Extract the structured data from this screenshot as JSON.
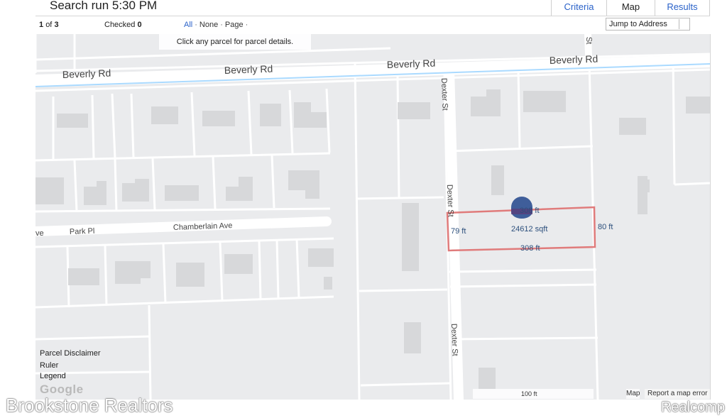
{
  "header": {
    "title": "Search run 5:30 PM",
    "tabs": {
      "criteria": "Criteria",
      "map": "Map",
      "results": "Results"
    }
  },
  "toolbar": {
    "position": "1",
    "of": "of",
    "total": "3",
    "checked_label": "Checked",
    "checked_count": "0",
    "selectors": {
      "all": "All",
      "none": "None",
      "page": "Page"
    },
    "jump_label": "Jump to Address"
  },
  "map": {
    "hint": "Click any parcel for parcel details.",
    "roads": {
      "beverly_1": "Beverly Rd",
      "beverly_2": "Beverly Rd",
      "beverly_3": "Beverly Rd",
      "beverly_4": "Beverly Rd",
      "dexter_1": "Dexter St",
      "dexter_2": "Dexter St",
      "dexter_3": "Dexter St",
      "st_fragment": "St",
      "ave_fragment": "ve",
      "park_pl": "Park Pl",
      "chamberlain": "Chamberlain Ave"
    },
    "parcel": {
      "top": "308 ft",
      "bottom": "308 ft",
      "left": "79 ft",
      "right": "80 ft",
      "area": "24612 sqft"
    },
    "overlays": {
      "disclaimer": "Parcel Disclaimer",
      "ruler": "Ruler",
      "legend": "Legend",
      "google": "Google",
      "scale": "100 ft",
      "map_data": "Map",
      "report": "Report a map error"
    },
    "colors": {
      "background": "#eaebed",
      "street": "#ffffff",
      "building": "#d7d8da",
      "water": "#aadaff",
      "parcel_outline": "#e07b7b",
      "marker": "#3f5e9a"
    }
  },
  "watermarks": {
    "left": "Brookstone Realtors",
    "right": "Realcomp"
  }
}
